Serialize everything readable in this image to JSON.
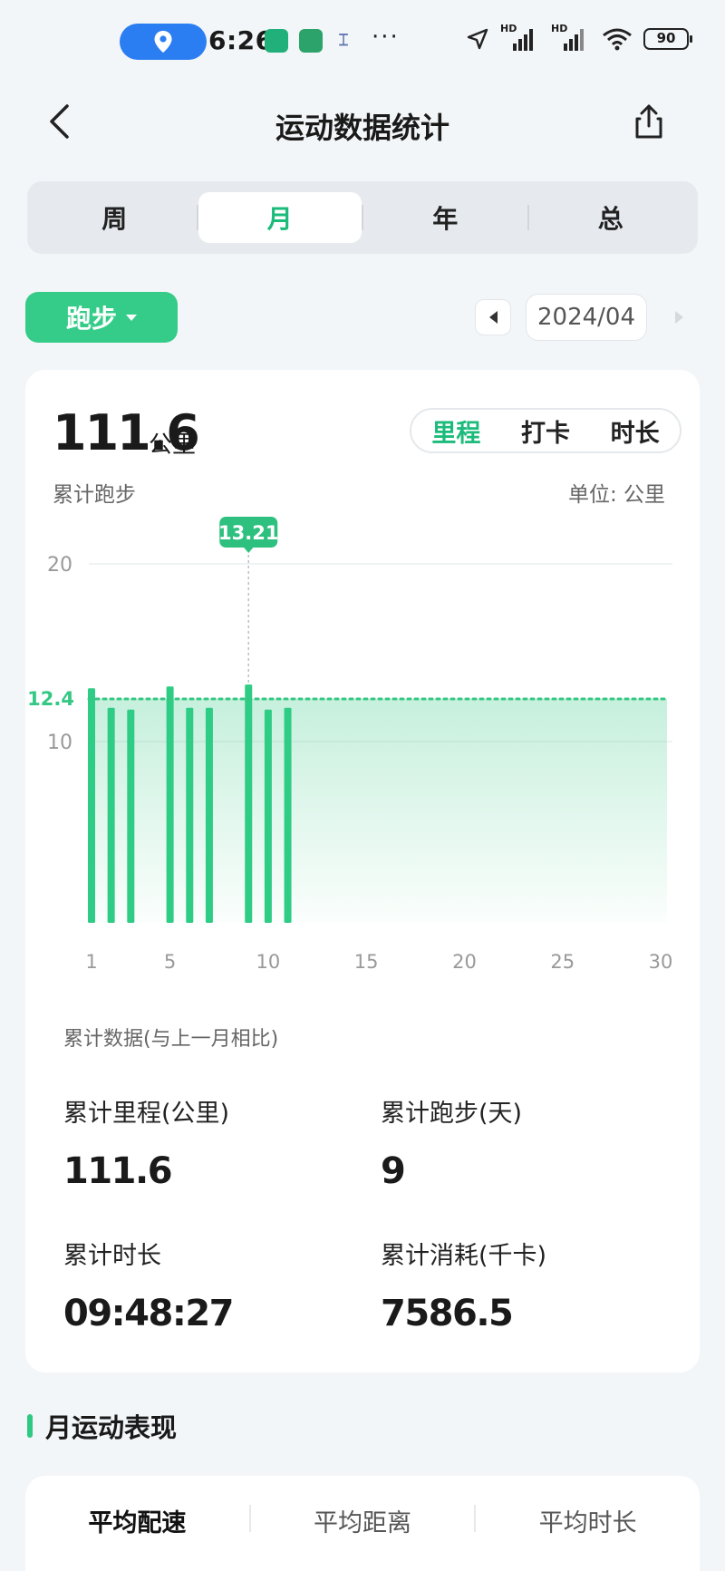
{
  "status_bar": {
    "time": "6:26",
    "battery": "90",
    "signal_label": "HD"
  },
  "header": {
    "title": "运动数据统计"
  },
  "period_tabs": [
    {
      "label": "周",
      "active": false
    },
    {
      "label": "月",
      "active": true
    },
    {
      "label": "年",
      "active": false
    },
    {
      "label": "总",
      "active": false
    }
  ],
  "sport_selector": {
    "label": "跑步"
  },
  "date_nav": {
    "current": "2024/04"
  },
  "summary": {
    "total_value": "111.6",
    "total_unit": "公里",
    "total_label": "累计跑步",
    "unit_note": "单位: 公里",
    "metric_tabs": [
      {
        "label": "里程",
        "active": true
      },
      {
        "label": "打卡",
        "active": false
      },
      {
        "label": "时长",
        "active": false
      }
    ]
  },
  "chart_data": {
    "type": "bar",
    "x": [
      1,
      2,
      3,
      4,
      5,
      6,
      7,
      8,
      9,
      10,
      11,
      12,
      13,
      14,
      15,
      16,
      17,
      18,
      19,
      20,
      21,
      22,
      23,
      24,
      25,
      26,
      27,
      28,
      29,
      30
    ],
    "values": [
      13.0,
      11.9,
      11.8,
      0,
      13.1,
      11.9,
      11.9,
      0,
      13.21,
      11.8,
      11.9,
      0,
      0,
      0,
      0,
      0,
      0,
      0,
      0,
      0,
      0,
      0,
      0,
      0,
      0,
      0,
      0,
      0,
      0,
      0
    ],
    "x_ticks": [
      "1",
      "5",
      "10",
      "15",
      "20",
      "25",
      "30"
    ],
    "x_tick_values": [
      1,
      5,
      10,
      15,
      20,
      25,
      30
    ],
    "y_ticks": [
      "20",
      "10"
    ],
    "y_tick_values": [
      20,
      10
    ],
    "ylim": [
      0,
      20
    ],
    "average": {
      "value": 12.4,
      "label": "12.4"
    },
    "highlight": {
      "x": 9,
      "label": "13.21"
    },
    "colors": {
      "bar": "#2ecc85",
      "average": "#34c884",
      "tooltip": "#2ec07f",
      "grid": "#eceff1"
    }
  },
  "stats": {
    "title": "累计数据(与上一月相比)",
    "items": [
      {
        "label": "累计里程(公里)",
        "value": "111.6"
      },
      {
        "label": "累计跑步(天)",
        "value": "9"
      },
      {
        "label": "累计时长",
        "value": "09:48:27"
      },
      {
        "label": "累计消耗(千卡)",
        "value": "7586.5"
      }
    ]
  },
  "performance": {
    "title": "月运动表现",
    "tabs": [
      {
        "label": "平均配速",
        "active": true
      },
      {
        "label": "平均距离",
        "active": false
      },
      {
        "label": "平均时长",
        "active": false
      }
    ]
  },
  "colors": {
    "accent": "#1dbb7b",
    "button": "#34cc88",
    "background": "#f3f6f8"
  }
}
